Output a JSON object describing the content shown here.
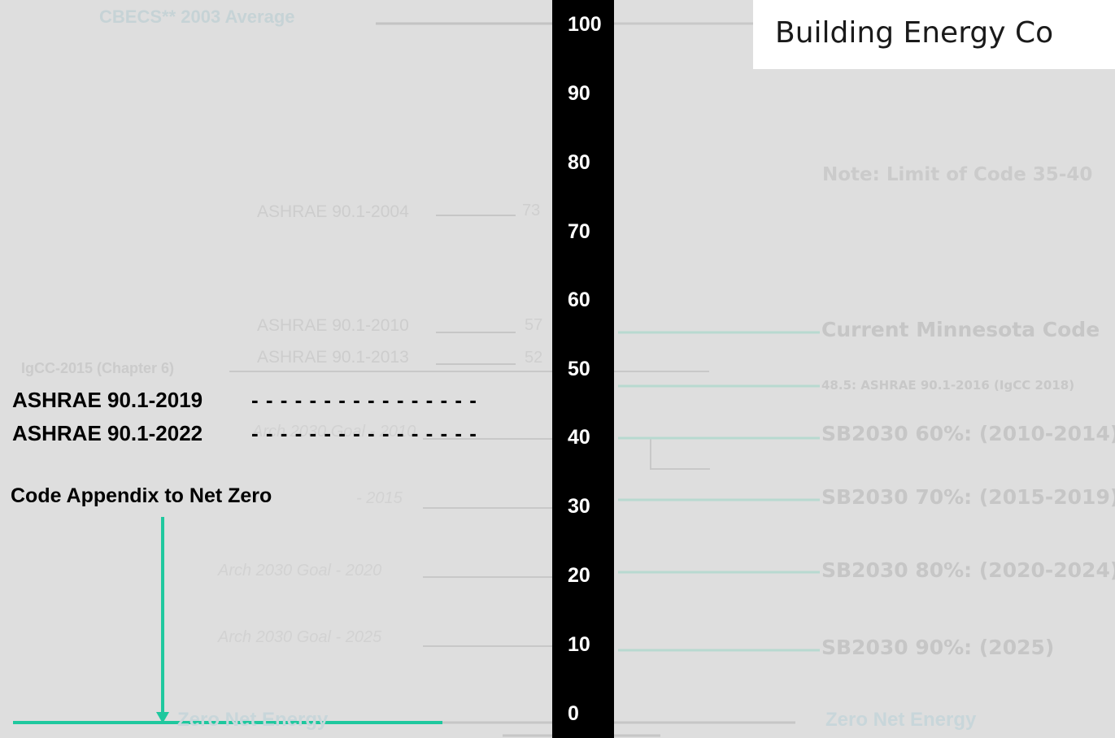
{
  "title": "Building Energy Co",
  "ruler_ticks": [
    "100",
    "90",
    "80",
    "70",
    "60",
    "50",
    "40",
    "30",
    "20",
    "10",
    "0"
  ],
  "background_left": {
    "cbecs": "CBECS** 2003 Average",
    "ashrae_2004": "ASHRAE 90.1-2004",
    "ashrae_2004_value": "73",
    "ashrae_2010": "ASHRAE 90.1-2010",
    "ashrae_2010_value": "57",
    "ashrae_2013": "ASHRAE 90.1-2013",
    "ashrae_2013_value": "52",
    "igcc": "IgCC-2015 (Chapter 6)",
    "arch_2010": "Arch 2030 Goal - 2010",
    "arch_2015": "- 2015",
    "arch_2020": "Arch 2030 Goal - 2020",
    "arch_2025": "Arch 2030 Goal - 2025",
    "zero_net_energy": "Zero Net Energy"
  },
  "right_labels": {
    "note": "Note: Limit of Code 35-40",
    "current_mn": "Current Minnesota Code",
    "ashrae_2016": "48.5: ASHRAE 90.1-2016 (IgCC 2018)",
    "sb2030_60": "SB2030 60%: (2010-2014)",
    "sb2030_70": "SB2030 70%: (2015-2019)",
    "sb2030_80": "SB2030 80%: (2020-2024)",
    "sb2030_90": "SB2030 90%: (2025)",
    "zero_net_energy": "Zero Net Energy"
  },
  "overlay": {
    "ashrae_2019": "ASHRAE 90.1-2019",
    "ashrae_2022": "ASHRAE 90.1-2022",
    "dashes": "- - - - - - - - - - - - - - - -",
    "appendix": "Code Appendix to Net Zero"
  },
  "colors": {
    "accent": "#1fc89e",
    "ruler": "#000000",
    "background": "#dedede"
  }
}
